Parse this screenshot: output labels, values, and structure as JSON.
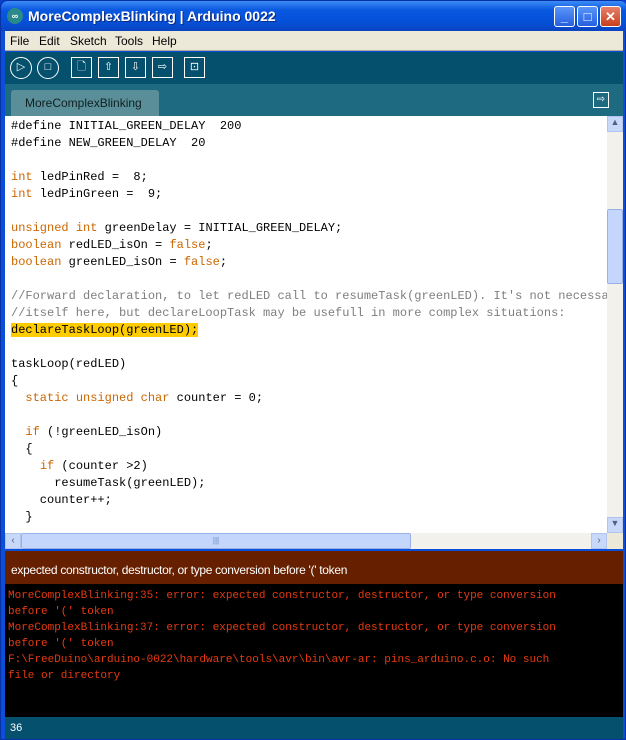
{
  "window": {
    "title": "MoreComplexBlinking | Arduino 0022",
    "controls": {
      "minimize": "_",
      "maximize": "□",
      "close": "✕"
    }
  },
  "menu": [
    "File",
    "Edit",
    "Sketch",
    "Tools",
    "Help"
  ],
  "toolbar": [
    {
      "name": "verify",
      "icon": "▷"
    },
    {
      "name": "stop",
      "icon": "□"
    },
    {
      "name": "new",
      "icon": "🗋"
    },
    {
      "name": "open",
      "icon": "⇧"
    },
    {
      "name": "save",
      "icon": "⇩"
    },
    {
      "name": "upload",
      "icon": "⇨"
    },
    {
      "name": "serial-monitor",
      "icon": "⊡"
    }
  ],
  "tab": {
    "label": "MoreComplexBlinking",
    "menu_icon": "⇨"
  },
  "code": [
    [
      [
        "#define INITIAL_GREEN_DELAY  200",
        ""
      ]
    ],
    [
      [
        "#define NEW_GREEN_DELAY  20",
        ""
      ]
    ],
    [],
    [
      [
        "int",
        "kw"
      ],
      [
        " ledPinRed =  8;",
        ""
      ]
    ],
    [
      [
        "int",
        "kw"
      ],
      [
        " ledPinGreen =  9;",
        ""
      ]
    ],
    [],
    [
      [
        "unsigned",
        "kw"
      ],
      [
        " ",
        ""
      ],
      [
        "int",
        "kw"
      ],
      [
        " greenDelay = INITIAL_GREEN_DELAY;",
        ""
      ]
    ],
    [
      [
        "boolean",
        "kw"
      ],
      [
        " redLED_isOn = ",
        ""
      ],
      [
        "false",
        "kw"
      ],
      [
        ";",
        ""
      ]
    ],
    [
      [
        "boolean",
        "kw"
      ],
      [
        " greenLED_isOn = ",
        ""
      ],
      [
        "false",
        "kw"
      ],
      [
        ";",
        ""
      ]
    ],
    [],
    [
      [
        "//Forward declaration, to let redLED call to resumeTask(greenLED). It's not necessary",
        "cm"
      ]
    ],
    [
      [
        "//itself here, but declareLoopTask may be usefull in more complex situations:",
        "cm"
      ]
    ],
    [
      [
        "declareTaskLoop(greenLED);",
        "hl"
      ]
    ],
    [],
    [
      [
        "taskLoop(redLED)",
        ""
      ]
    ],
    [
      [
        "{",
        ""
      ]
    ],
    [
      [
        "  ",
        ""
      ],
      [
        "static",
        "kw"
      ],
      [
        " ",
        ""
      ],
      [
        "unsigned",
        "kw"
      ],
      [
        " ",
        ""
      ],
      [
        "char",
        "kw"
      ],
      [
        " counter = 0;",
        ""
      ]
    ],
    [],
    [
      [
        "  ",
        ""
      ],
      [
        "if",
        "kw"
      ],
      [
        " (!greenLED_isOn)",
        ""
      ]
    ],
    [
      [
        "  {",
        ""
      ]
    ],
    [
      [
        "    ",
        ""
      ],
      [
        "if",
        "kw"
      ],
      [
        " (counter >2)",
        ""
      ]
    ],
    [
      [
        "      resumeTask(greenLED);",
        ""
      ]
    ],
    [
      [
        "    counter++;",
        ""
      ]
    ],
    [
      [
        "  }",
        ""
      ]
    ]
  ],
  "error_header": "expected constructor, destructor, or type conversion before '(' token",
  "console": [
    "MoreComplexBlinking:35: error: expected constructor, destructor, or type conversion",
    "before '(' token",
    "MoreComplexBlinking:37: error: expected constructor, destructor, or type conversion",
    "before '(' token",
    "F:\\FreeDuino\\arduino-0022\\hardware\\tools\\avr\\bin\\avr-ar: pins_arduino.c.o: No such",
    "file or directory"
  ],
  "status": {
    "line": "36"
  }
}
